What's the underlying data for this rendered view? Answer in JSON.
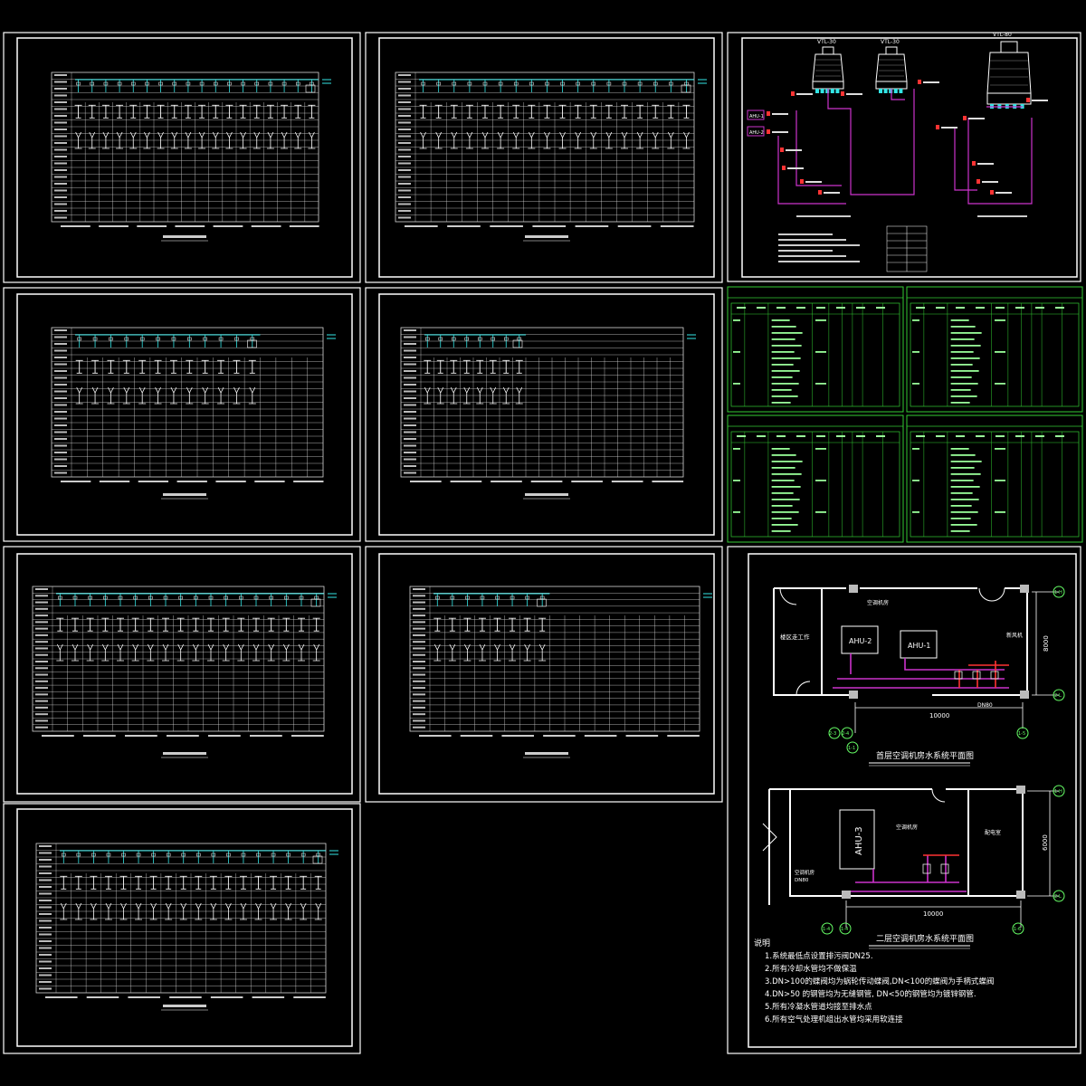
{
  "colors": {
    "background": "#000000",
    "frame": "#ffffff",
    "cyan": "#33e6e6",
    "magenta": "#cc33cc",
    "green": "#33cc33",
    "yellow": "#ffff66",
    "red": "#ff3333",
    "tableWhite": "#d8d8d8"
  },
  "towerSheet": {
    "towers": [
      "VTL-30",
      "VTL-30",
      "VTL-80"
    ],
    "boxLabels": [
      "AHU-1",
      "AHU-2"
    ]
  },
  "floorPlan1": {
    "title": "首层空调机房水系统平面图",
    "roomLabel": "空调机房",
    "leftRoom": "楼区走工作",
    "rightRoom": "新风机",
    "units": [
      "AHU-2",
      "AHU-1"
    ],
    "dimWidth": "10000",
    "dimHeight": "8000",
    "pipeLabel": "DN80",
    "axisLeft": [
      "2-3",
      "2-4"
    ],
    "axisRight": "1-5",
    "axisTop": "1-H",
    "axisBottom": "2-L",
    "axisExtra": "1-1"
  },
  "floorPlan2": {
    "title": "二层空调机房水系统平面图",
    "roomLabel": "空调机房",
    "leftRoom": "空调机房",
    "rightRoom": "配电室",
    "unit": "AHU-3",
    "dimWidth": "10000",
    "dimHeight": "6000",
    "pipeLabel": "DN80",
    "axisLeft": [
      "1-4",
      "1-4"
    ],
    "axisRight": "1-6",
    "axisTop": "1-H",
    "axisBottom": "2-L"
  },
  "notes": {
    "heading": "说明",
    "items": [
      "1.系统最低点设置排污阀DN25.",
      "2.所有冷却水管均不做保温",
      "3.DN>100的蝶阀均为蜗轮传动蝶阀,DN<100的蝶阀为手柄式蝶阀",
      "4.DN>50 的钢管均为无缝钢管, DN<50的钢管均为镀锌钢管.",
      "5.所有冷凝水管道均接至排水点",
      "6.所有空气处理机组出水管均采用软连接"
    ]
  }
}
